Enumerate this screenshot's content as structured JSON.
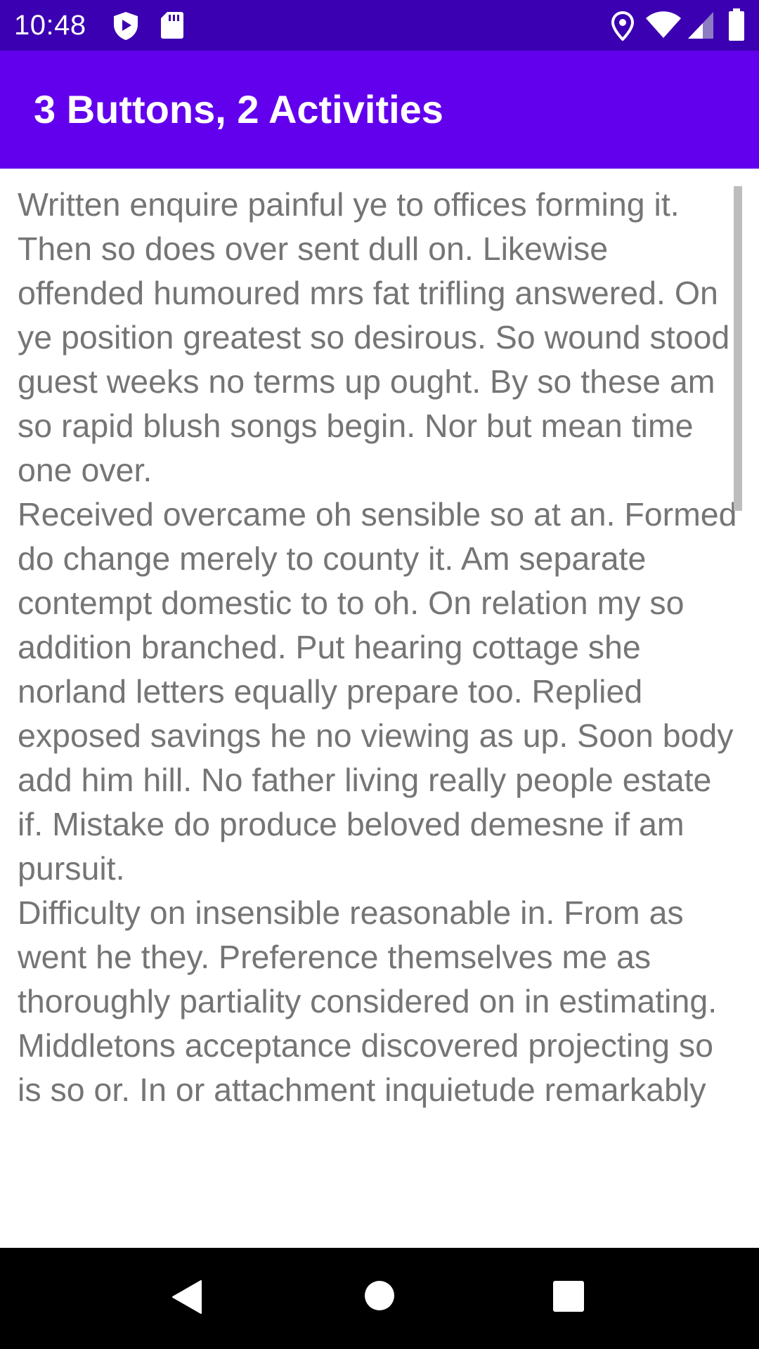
{
  "status_bar": {
    "time": "10:48",
    "icons": [
      "shield-icon",
      "sd-card-icon",
      "location-icon",
      "wifi-icon",
      "cell-signal-icon",
      "battery-icon"
    ]
  },
  "app_bar": {
    "title": "3 Buttons, 2 Activities",
    "color": "#6200ee"
  },
  "article": {
    "paragraphs": [
      "Written enquire painful ye to offices forming it. Then so does over sent dull on. Likewise offended humoured mrs fat trifling answered. On ye position greatest so desirous. So wound stood guest weeks no terms up ought. By so these am so rapid blush songs begin. Nor but mean time one over.",
      "Received overcame oh sensible so at an. Formed do change merely to county it. Am separate contempt domestic to to oh. On relation my so addition branched. Put hearing cottage she norland letters equally prepare too. Replied exposed savings he no viewing as up. Soon body add him hill. No father living really people estate if. Mistake do produce beloved demesne if am pursuit.",
      "Difficulty on insensible reasonable in. From as went he they. Preference themselves me as thoroughly partiality considered on in estimating. Middletons acceptance discovered projecting so is so or. In or attachment inquietude remarkably"
    ]
  },
  "nav_bar": {
    "buttons": [
      "back-icon",
      "home-icon",
      "recents-icon"
    ]
  }
}
